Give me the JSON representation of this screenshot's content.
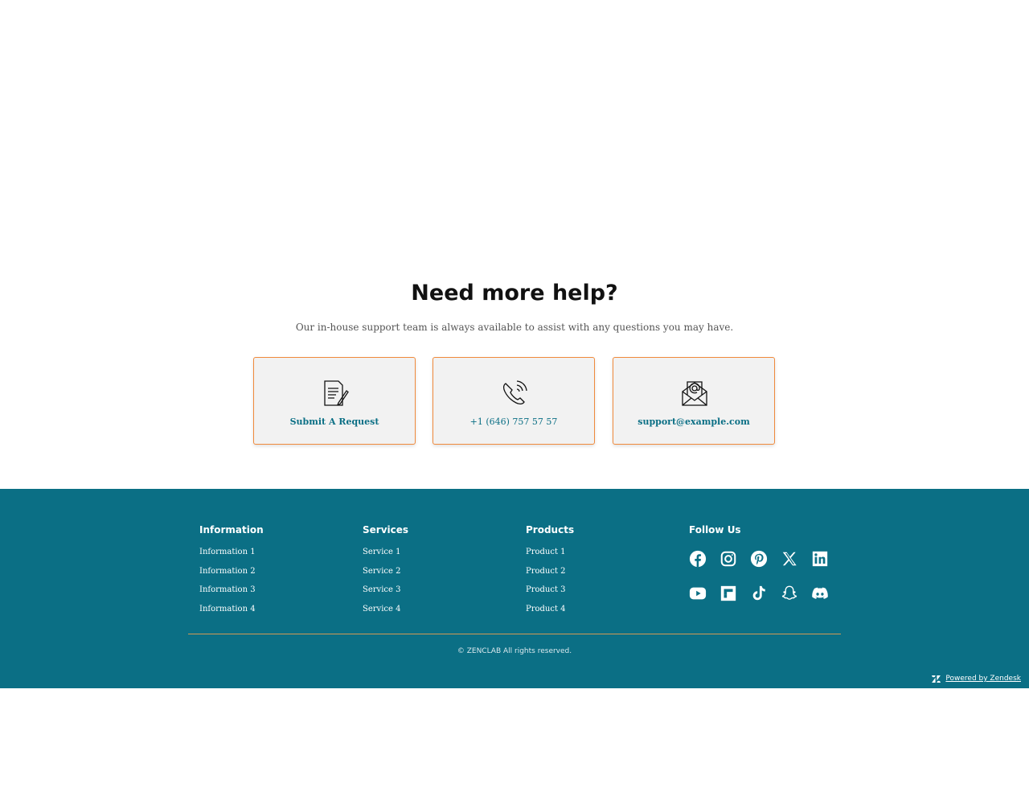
{
  "help": {
    "title": "Need more help?",
    "subtitle": "Our in-house support team is always available to assist with any questions you may have.",
    "cards": [
      {
        "label": "Submit A Request",
        "icon": "document-edit-icon"
      },
      {
        "label": "+1 (646) 757 57 57",
        "icon": "phone-icon"
      },
      {
        "label": "support@example.com",
        "icon": "envelope-at-icon"
      }
    ]
  },
  "footer": {
    "columns": [
      {
        "title": "Information",
        "items": [
          "Information 1",
          "Information 2",
          "Information 3",
          "Information 4"
        ]
      },
      {
        "title": "Services",
        "items": [
          "Service 1",
          "Service 2",
          "Service 3",
          "Service 4"
        ]
      },
      {
        "title": "Products",
        "items": [
          "Product 1",
          "Product 2",
          "Product 3",
          "Product 4"
        ]
      }
    ],
    "follow_title": "Follow Us",
    "social_row1": [
      "facebook-icon",
      "instagram-icon",
      "pinterest-icon",
      "x-icon",
      "linkedin-icon"
    ],
    "social_row2": [
      "youtube-icon",
      "flipboard-icon",
      "tiktok-icon",
      "snapchat-icon",
      "discord-icon"
    ],
    "copyright": "© ZENCLAB All rights reserved.",
    "powered_by": "Powered by Zendesk"
  },
  "colors": {
    "footer_bg": "#0b6f85",
    "accent": "#f08a3c",
    "link": "#0b6f85",
    "divider": "#d39a53"
  }
}
